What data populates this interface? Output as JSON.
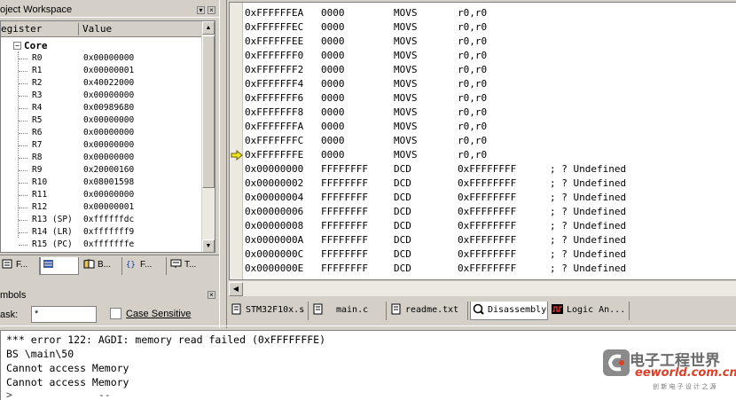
{
  "workspace": {
    "title": "oject Workspace",
    "col_register": "egister",
    "col_value": "Value",
    "group": "Core",
    "registers": [
      {
        "name": "R0",
        "value": "0x00000000"
      },
      {
        "name": "R1",
        "value": "0x00000001"
      },
      {
        "name": "R2",
        "value": "0x40022000"
      },
      {
        "name": "R3",
        "value": "0x00000000"
      },
      {
        "name": "R4",
        "value": "0x00989680"
      },
      {
        "name": "R5",
        "value": "0x00000000"
      },
      {
        "name": "R6",
        "value": "0x00000000"
      },
      {
        "name": "R7",
        "value": "0x00000000"
      },
      {
        "name": "R8",
        "value": "0x00000000"
      },
      {
        "name": "R9",
        "value": "0x20000160"
      },
      {
        "name": "R10",
        "value": "0x08001598"
      },
      {
        "name": "R11",
        "value": "0x00000000"
      },
      {
        "name": "R12",
        "value": "0x00000001"
      },
      {
        "name": "R13 (SP)",
        "value": "0xffffffdc"
      },
      {
        "name": "R14 (LR)",
        "value": "0xfffffff9"
      },
      {
        "name": "R15 (PC)",
        "value": "0xfffffffe"
      }
    ],
    "tabs": [
      "F...",
      "",
      "B...",
      "F...",
      "T..."
    ]
  },
  "symbols": {
    "title": "mbols",
    "mask_label": "ask:",
    "mask_value": "*",
    "case_sensitive": "Case Sensitive"
  },
  "disassembly": {
    "lines": [
      {
        "addr": "0xFFFFFFEA",
        "op": "0000",
        "mn": "MOVS",
        "ops": "r0,r0",
        "cmt": ""
      },
      {
        "addr": "0xFFFFFFEC",
        "op": "0000",
        "mn": "MOVS",
        "ops": "r0,r0",
        "cmt": ""
      },
      {
        "addr": "0xFFFFFFEE",
        "op": "0000",
        "mn": "MOVS",
        "ops": "r0,r0",
        "cmt": ""
      },
      {
        "addr": "0xFFFFFFF0",
        "op": "0000",
        "mn": "MOVS",
        "ops": "r0,r0",
        "cmt": ""
      },
      {
        "addr": "0xFFFFFFF2",
        "op": "0000",
        "mn": "MOVS",
        "ops": "r0,r0",
        "cmt": ""
      },
      {
        "addr": "0xFFFFFFF4",
        "op": "0000",
        "mn": "MOVS",
        "ops": "r0,r0",
        "cmt": ""
      },
      {
        "addr": "0xFFFFFFF6",
        "op": "0000",
        "mn": "MOVS",
        "ops": "r0,r0",
        "cmt": ""
      },
      {
        "addr": "0xFFFFFFF8",
        "op": "0000",
        "mn": "MOVS",
        "ops": "r0,r0",
        "cmt": ""
      },
      {
        "addr": "0xFFFFFFFA",
        "op": "0000",
        "mn": "MOVS",
        "ops": "r0,r0",
        "cmt": ""
      },
      {
        "addr": "0xFFFFFFFC",
        "op": "0000",
        "mn": "MOVS",
        "ops": "r0,r0",
        "cmt": ""
      },
      {
        "addr": "0xFFFFFFFE",
        "op": "0000",
        "mn": "MOVS",
        "ops": "r0,r0",
        "cmt": ""
      },
      {
        "addr": "0x00000000",
        "op": "FFFFFFFF",
        "mn": "DCD",
        "ops": "0xFFFFFFFF",
        "cmt": "; ? Undefined"
      },
      {
        "addr": "0x00000002",
        "op": "FFFFFFFF",
        "mn": "DCD",
        "ops": "0xFFFFFFFF",
        "cmt": "; ? Undefined"
      },
      {
        "addr": "0x00000004",
        "op": "FFFFFFFF",
        "mn": "DCD",
        "ops": "0xFFFFFFFF",
        "cmt": "; ? Undefined"
      },
      {
        "addr": "0x00000006",
        "op": "FFFFFFFF",
        "mn": "DCD",
        "ops": "0xFFFFFFFF",
        "cmt": "; ? Undefined"
      },
      {
        "addr": "0x00000008",
        "op": "FFFFFFFF",
        "mn": "DCD",
        "ops": "0xFFFFFFFF",
        "cmt": "; ? Undefined"
      },
      {
        "addr": "0x0000000A",
        "op": "FFFFFFFF",
        "mn": "DCD",
        "ops": "0xFFFFFFFF",
        "cmt": "; ? Undefined"
      },
      {
        "addr": "0x0000000C",
        "op": "FFFFFFFF",
        "mn": "DCD",
        "ops": "0xFFFFFFFF",
        "cmt": "; ? Undefined"
      },
      {
        "addr": "0x0000000E",
        "op": "FFFFFFFF",
        "mn": "DCD",
        "ops": "0xFFFFFFFF",
        "cmt": "; ? Undefined"
      }
    ],
    "current_index": 10
  },
  "editor_tabs": [
    "STM32F10x.s",
    "main.c",
    "readme.txt",
    "Disassembly",
    "Logic An..."
  ],
  "output": {
    "lines": [
      "*** error 122: AGDI: memory read failed (0xFFFFFFFE)",
      "BS \\main\\50",
      "Cannot access Memory",
      "Cannot access Memory"
    ]
  },
  "watermark": {
    "cn": "电子工程世界",
    "en": "eeworld.com.cn",
    "sub": "创 新 电 子 设 计 之 源"
  },
  "colors": {
    "arrow": "#f2e51c",
    "brand_red": "#d9412a"
  }
}
